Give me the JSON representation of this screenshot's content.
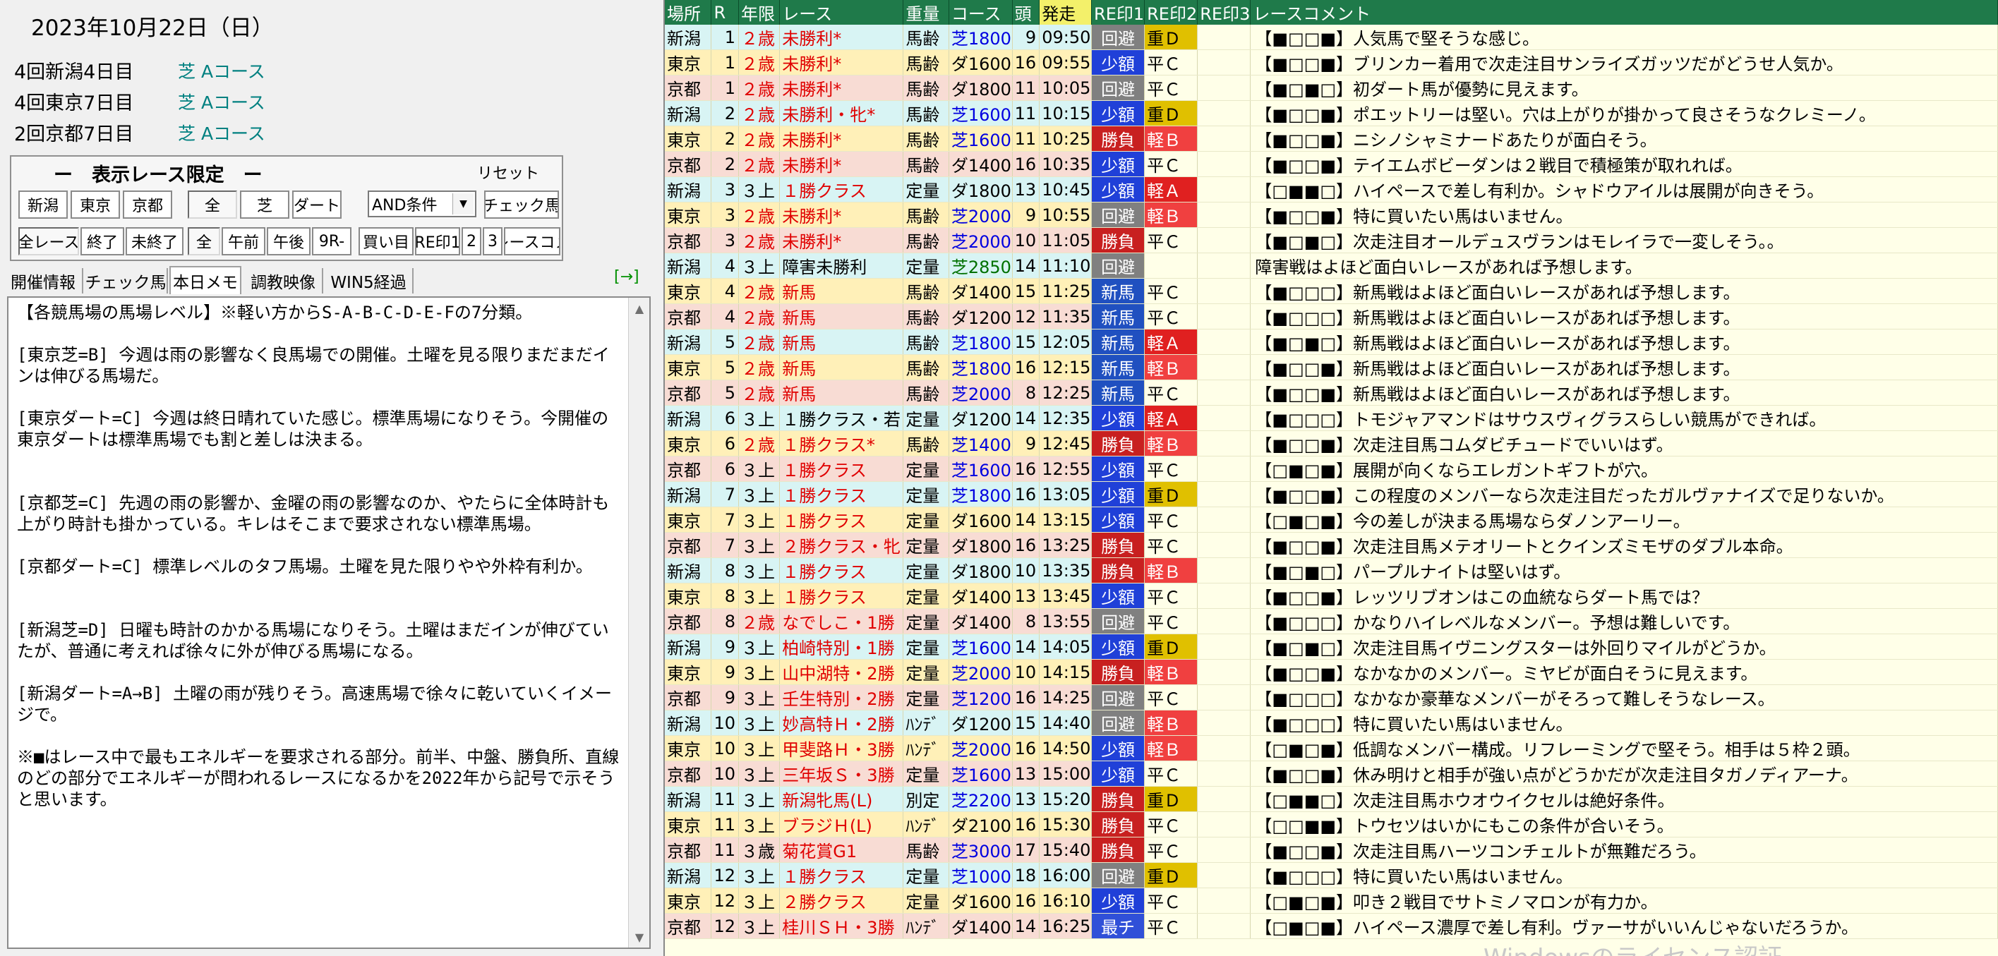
{
  "left": {
    "date": "2023年10月22日（日）",
    "meetings": [
      {
        "name": "4回新潟4日目",
        "course": "芝 Aコース"
      },
      {
        "name": "4回東京7日目",
        "course": "芝 Aコース"
      },
      {
        "name": "2回京都7日目",
        "course": "芝 Aコース"
      }
    ],
    "filter": {
      "title": "ー　表示レース限定　ー",
      "reset": "リセット",
      "row1": [
        "新潟",
        "東京",
        "京都",
        "全",
        "芝",
        "ダート"
      ],
      "condition_select": "AND条件",
      "check_horse": "チェック馬",
      "row2": [
        "全レース",
        "終了",
        "未終了",
        "全",
        "午前",
        "午後",
        "9R-",
        "買い目",
        "RE印1",
        "2",
        "3",
        "レースコメ"
      ]
    },
    "tabs": [
      "開催情報",
      "チェック馬",
      "本日メモ",
      "調教映像",
      "WIN5経過"
    ],
    "tab_arrow": "[→]",
    "memo": "【各競馬場の馬場レベル】※軽い方からS-A-B-C-D-E-Fの7分類。\n\n[東京芝=B] 今週は雨の影響なく良馬場での開催。土曜を見る限りまだまだインは伸びる馬場だ。\n\n[東京ダート=C] 今週は終日晴れていた感じ。標準馬場になりそう。今開催の東京ダートは標準馬場でも割と差しは決まる。\n\n\n[京都芝=C] 先週の雨の影響か、金曜の雨の影響なのか、やたらに全体時計も上がり時計も掛かっている。キレはそこまで要求されない標準馬場。\n\n[京都ダート=C] 標準レベルのタフ馬場。土曜を見た限りやや外枠有利か。\n\n\n[新潟芝=D] 日曜も時計のかかる馬場になりそう。土曜はまだインが伸びていたが、普通に考えれば徐々に外が伸びる馬場になる。\n\n[新潟ダート=A→B] 土曜の雨が残りそう。高速馬場で徐々に乾いていくイメージで。\n\n※■はレース中で最もエネルギーを要求される部分。前半、中盤、勝負所、直線のどの部分でエネルギーが問われるレースになるかを2022年から記号で示そうと思います。"
  },
  "table": {
    "headers": [
      "場所",
      "R",
      "年限",
      "レース",
      "重量",
      "コース",
      "頭",
      "発走",
      "RE印1",
      "RE印2",
      "RE印3",
      "レースコメント"
    ],
    "rows": [
      [
        "新潟",
        "1",
        "２歳",
        "未勝利*",
        "馬齢",
        "芝1800",
        "9",
        "09:50",
        "回避",
        "重Ｄ",
        "",
        "【■□□■】人気馬で堅そうな感じ。"
      ],
      [
        "東京",
        "1",
        "２歳",
        "未勝利*",
        "馬齢",
        "ダ1600",
        "16",
        "09:55",
        "少額",
        "平Ｃ",
        "",
        "【■□□■】ブリンカー着用で次走注目サンライズガッツだがどうせ人気か。"
      ],
      [
        "京都",
        "1",
        "２歳",
        "未勝利*",
        "馬齢",
        "ダ1800",
        "11",
        "10:05",
        "回避",
        "平Ｃ",
        "",
        "【■□■□】初ダート馬が優勢に見えます。"
      ],
      [
        "新潟",
        "2",
        "２歳",
        "未勝利・牝*",
        "馬齢",
        "芝1600",
        "11",
        "10:15",
        "少額",
        "重Ｄ",
        "",
        "【■□□■】ポエットリーは堅い。穴は上がりが掛かって良さそうなクレミーノ。"
      ],
      [
        "東京",
        "2",
        "２歳",
        "未勝利*",
        "馬齢",
        "芝1600",
        "11",
        "10:25",
        "勝負",
        "軽Ｂ",
        "",
        "【■□□■】ニシノシャミナードあたりが面白そう。"
      ],
      [
        "京都",
        "2",
        "２歳",
        "未勝利*",
        "馬齢",
        "ダ1400",
        "16",
        "10:35",
        "少額",
        "平Ｃ",
        "",
        "【■□□■】テイエムボビーダンは２戦目で積極策が取れれば。"
      ],
      [
        "新潟",
        "3",
        "３上",
        "１勝クラス",
        "定量",
        "ダ1800",
        "13",
        "10:45",
        "少額",
        "軽Ａ",
        "",
        "【□■■□】ハイペースで差し有利か。シャドウアイルは展開が向きそう。"
      ],
      [
        "東京",
        "3",
        "２歳",
        "未勝利*",
        "馬齢",
        "芝2000",
        "9",
        "10:55",
        "回避",
        "軽Ｂ",
        "",
        "【■□□■】特に買いたい馬はいません。"
      ],
      [
        "京都",
        "3",
        "２歳",
        "未勝利*",
        "馬齢",
        "芝2000",
        "10",
        "11:05",
        "勝負",
        "平Ｃ",
        "",
        "【■□■□】次走注目オールデュスヴランはモレイラで一変しそう。。"
      ],
      [
        "新潟",
        "4",
        "３上",
        "障害未勝利",
        "定量",
        "芝2850",
        "14",
        "11:10",
        "回避",
        "",
        "",
        "障害戦はよほど面白いレースがあれば予想します。"
      ],
      [
        "東京",
        "4",
        "２歳",
        "新馬",
        "馬齢",
        "ダ1400",
        "15",
        "11:25",
        "新馬",
        "平Ｃ",
        "",
        "【■□□□】新馬戦はよほど面白いレースがあれば予想します。"
      ],
      [
        "京都",
        "4",
        "２歳",
        "新馬",
        "馬齢",
        "ダ1200",
        "12",
        "11:35",
        "新馬",
        "平Ｃ",
        "",
        "【■□□□】新馬戦はよほど面白いレースがあれば予想します。"
      ],
      [
        "新潟",
        "5",
        "２歳",
        "新馬",
        "馬齢",
        "芝1800",
        "15",
        "12:05",
        "新馬",
        "軽Ａ",
        "",
        "【■□■□】新馬戦はよほど面白いレースがあれば予想します。"
      ],
      [
        "東京",
        "5",
        "２歳",
        "新馬",
        "馬齢",
        "芝1800",
        "16",
        "12:15",
        "新馬",
        "軽Ｂ",
        "",
        "【■□□■】新馬戦はよほど面白いレースがあれば予想します。"
      ],
      [
        "京都",
        "5",
        "２歳",
        "新馬",
        "馬齢",
        "芝2000",
        "8",
        "12:25",
        "新馬",
        "平Ｃ",
        "",
        "【■□□■】新馬戦はよほど面白いレースがあれば予想します。"
      ],
      [
        "新潟",
        "6",
        "３上",
        "１勝クラス・若",
        "定量",
        "ダ1200",
        "14",
        "12:35",
        "少額",
        "軽Ａ",
        "",
        "【■□□□】トモジャアマンドはサウスヴィグラスらしい競馬ができれば。"
      ],
      [
        "東京",
        "6",
        "２歳",
        "１勝クラス*",
        "馬齢",
        "芝1400",
        "9",
        "12:45",
        "勝負",
        "軽Ｂ",
        "",
        "【■□□■】次走注目馬コムダビチュードでいいはず。"
      ],
      [
        "京都",
        "6",
        "３上",
        "１勝クラス",
        "定量",
        "芝1600",
        "16",
        "12:55",
        "少額",
        "平Ｃ",
        "",
        "【□■□■】展開が向くならエレガントギフトが穴。"
      ],
      [
        "新潟",
        "7",
        "３上",
        "１勝クラス",
        "定量",
        "芝1800",
        "16",
        "13:05",
        "少額",
        "重Ｄ",
        "",
        "【■□□■】この程度のメンバーなら次走注目だったガルヴァナイズで足りないか。"
      ],
      [
        "東京",
        "7",
        "３上",
        "１勝クラス",
        "定量",
        "ダ1600",
        "14",
        "13:15",
        "少額",
        "平Ｃ",
        "",
        "【□■□■】今の差しが決まる馬場ならダノンアーリー。"
      ],
      [
        "京都",
        "7",
        "３上",
        "２勝クラス・牝",
        "定量",
        "ダ1800",
        "16",
        "13:25",
        "勝負",
        "平Ｃ",
        "",
        "【■□□■】次走注目馬メテオリートとクインズミモザのダブル本命。"
      ],
      [
        "新潟",
        "8",
        "３上",
        "１勝クラス",
        "定量",
        "ダ1800",
        "10",
        "13:35",
        "勝負",
        "軽Ｂ",
        "",
        "【■□■□】パープルナイトは堅いはず。"
      ],
      [
        "東京",
        "8",
        "３上",
        "１勝クラス",
        "定量",
        "ダ1400",
        "13",
        "13:45",
        "少額",
        "平Ｃ",
        "",
        "【■□□■】レッツリブオンはこの血統ならダート馬では？"
      ],
      [
        "京都",
        "8",
        "２歳",
        "なでしこ・1勝",
        "定量",
        "ダ1400",
        "8",
        "13:55",
        "回避",
        "平Ｃ",
        "",
        "【■□□□】かなりハイレベルなメンバー。予想は難しいです。"
      ],
      [
        "新潟",
        "9",
        "３上",
        "柏崎特別・1勝",
        "定量",
        "芝1600",
        "14",
        "14:05",
        "少額",
        "重Ｄ",
        "",
        "【■□■□】次走注目馬イヴニングスターは外回りマイルがどうか。"
      ],
      [
        "東京",
        "9",
        "３上",
        "山中湖特・2勝",
        "定量",
        "芝2000",
        "10",
        "14:15",
        "勝負",
        "軽Ｂ",
        "",
        "【■□□■】なかなかのメンバー。ミヤビが面白そうに見えます。"
      ],
      [
        "京都",
        "9",
        "３上",
        "壬生特別・2勝",
        "定量",
        "芝1200",
        "16",
        "14:25",
        "回避",
        "平Ｃ",
        "",
        "【■□□□】なかなか豪華なメンバーがそろって難しそうなレース。"
      ],
      [
        "新潟",
        "10",
        "３上",
        "妙高特Ｈ・2勝",
        "ﾊﾝﾃﾞ",
        "ダ1200",
        "15",
        "14:40",
        "回避",
        "軽Ｂ",
        "",
        "【■□□□】特に買いたい馬はいません。"
      ],
      [
        "東京",
        "10",
        "３上",
        "甲斐路Ｈ・3勝",
        "ﾊﾝﾃﾞ",
        "芝2000",
        "16",
        "14:50",
        "少額",
        "軽Ｂ",
        "",
        "【□■□■】低調なメンバー構成。リフレーミングで堅そう。相手は５枠２頭。"
      ],
      [
        "京都",
        "10",
        "３上",
        "三年坂Ｓ・3勝",
        "定量",
        "芝1600",
        "13",
        "15:00",
        "少額",
        "平Ｃ",
        "",
        "【■□□■】休み明けと相手が強い点がどうかだが次走注目タガノディアーナ。"
      ],
      [
        "新潟",
        "11",
        "３上",
        "新潟牝馬(L)",
        "別定",
        "芝2200",
        "13",
        "15:20",
        "勝負",
        "重Ｄ",
        "",
        "【□■■□】次走注目馬ホウオウイクセルは絶好条件。"
      ],
      [
        "東京",
        "11",
        "３上",
        "ブラジＨ(L)",
        "ﾊﾝﾃﾞ",
        "ダ2100",
        "16",
        "15:30",
        "勝負",
        "平Ｃ",
        "",
        "【□□■■】トウセツはいかにもこの条件が合いそう。"
      ],
      [
        "京都",
        "11",
        "３歳",
        "菊花賞G1",
        "馬齢",
        "芝3000",
        "17",
        "15:40",
        "勝負",
        "平Ｃ",
        "",
        "【■□□■】次走注目馬ハーツコンチェルトが無難だろう。"
      ],
      [
        "新潟",
        "12",
        "３上",
        "１勝クラス",
        "定量",
        "芝1000",
        "18",
        "16:00",
        "回避",
        "重Ｄ",
        "",
        "【■□□□】特に買いたい馬はいません。"
      ],
      [
        "東京",
        "12",
        "３上",
        "２勝クラス",
        "定量",
        "ダ1600",
        "16",
        "16:10",
        "少額",
        "平Ｃ",
        "",
        "【□■□■】叩き２戦目でサトミノマロンが有力か。"
      ],
      [
        "京都",
        "12",
        "３上",
        "桂川ＳＨ・3勝",
        "ﾊﾝﾃﾞ",
        "ダ1400",
        "14",
        "16:25",
        "最チ",
        "平Ｃ",
        "",
        "【□■□■】ハイペース濃厚で差し有利。ヴァーサがいいんじゃないだろうか。"
      ]
    ]
  },
  "watermark": "Windowsのライセンス認証",
  "colors": {
    "header_bg": "#1f7a4a",
    "niigata": "#d8f4f4",
    "tokyo": "#fff0b8",
    "kyoto": "#f8dcd4",
    "kaihi": "#808080",
    "shogaku": "#2040d8",
    "shobu": "#c82020",
    "shinba": "#2050c0",
    "saichi": "#3050d8",
    "omo_d": "#e0c000",
    "karu_b": "#f04040",
    "karu_a": "#e02020"
  }
}
